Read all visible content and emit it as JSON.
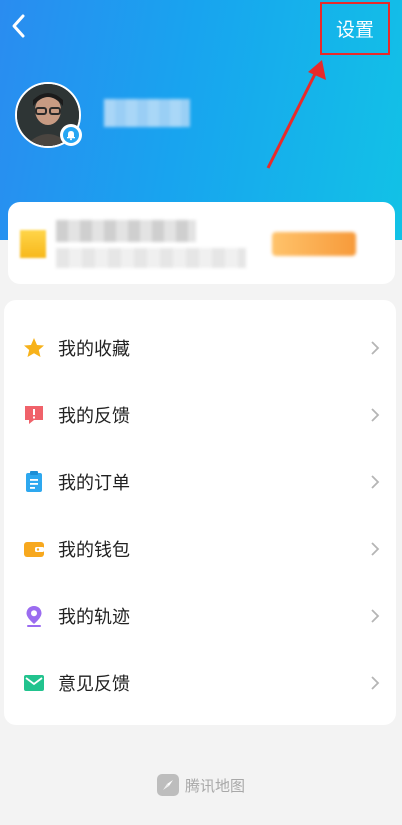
{
  "header": {
    "settings_label": "设置",
    "back_icon": "chevron-left-icon",
    "annotation_color": "#e82a2a"
  },
  "profile": {
    "avatar_icon": "avatar",
    "badge_icon": "bell-icon"
  },
  "menu": {
    "items": [
      {
        "label": "我的收藏",
        "icon": "star-icon",
        "color": "#f7b21a"
      },
      {
        "label": "我的反馈",
        "icon": "feedback-alert-icon",
        "color": "#f0626a"
      },
      {
        "label": "我的订单",
        "icon": "clipboard-icon",
        "color": "#2ea8ef"
      },
      {
        "label": "我的钱包",
        "icon": "wallet-icon",
        "color": "#f7a81e"
      },
      {
        "label": "我的轨迹",
        "icon": "location-pin-icon",
        "color": "#9b6cf0"
      },
      {
        "label": "意见反馈",
        "icon": "mail-icon",
        "color": "#22c38e"
      }
    ]
  },
  "footer": {
    "brand": "腾讯地图",
    "logo_icon": "compass-icon"
  }
}
